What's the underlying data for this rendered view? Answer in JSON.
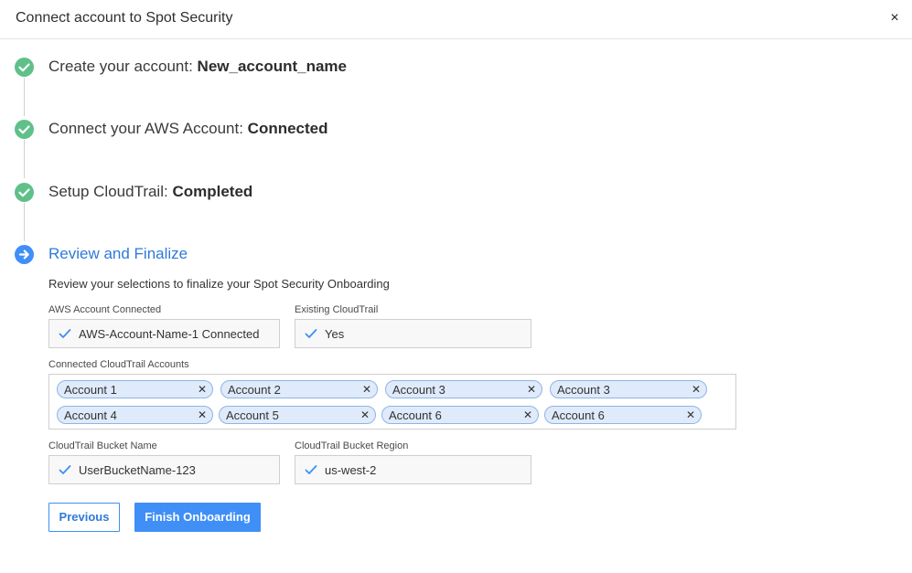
{
  "dialog": {
    "title": "Connect account to Spot Security",
    "close_glyph": "×"
  },
  "steps": [
    {
      "prefix": "Create your account:",
      "value": "New_account_name",
      "status": "done"
    },
    {
      "prefix": "Connect your AWS Account:",
      "value": "Connected",
      "status": "done"
    },
    {
      "prefix": "Setup CloudTrail:",
      "value": "Completed",
      "status": "done"
    },
    {
      "prefix": "Review and Finalize",
      "value": "",
      "status": "active"
    }
  ],
  "review": {
    "subtitle": "Review your selections to finalize your Spot Security Onboarding",
    "aws_account": {
      "label": "AWS Account Connected",
      "value": "AWS-Account-Name-1 Connected"
    },
    "existing_cloudtrail": {
      "label": "Existing CloudTrail",
      "value": "Yes"
    },
    "connected_accounts": {
      "label": "Connected CloudTrail Accounts",
      "tags": [
        "Account 1",
        "Account 2",
        "Account 3",
        "Account 3",
        "Account 4",
        "Account 5",
        "Account 6",
        "Account 6"
      ]
    },
    "bucket_name": {
      "label": "CloudTrail Bucket Name",
      "value": "UserBucketName-123"
    },
    "bucket_region": {
      "label": "CloudTrail Bucket Region",
      "value": "us-west-2"
    }
  },
  "buttons": {
    "previous": "Previous",
    "finish": "Finish Onboarding"
  },
  "colors": {
    "done": "#5fc08a",
    "active": "#3f8ff6",
    "tag_bg": "#dfeafb",
    "tag_border": "#8fb4e6"
  }
}
